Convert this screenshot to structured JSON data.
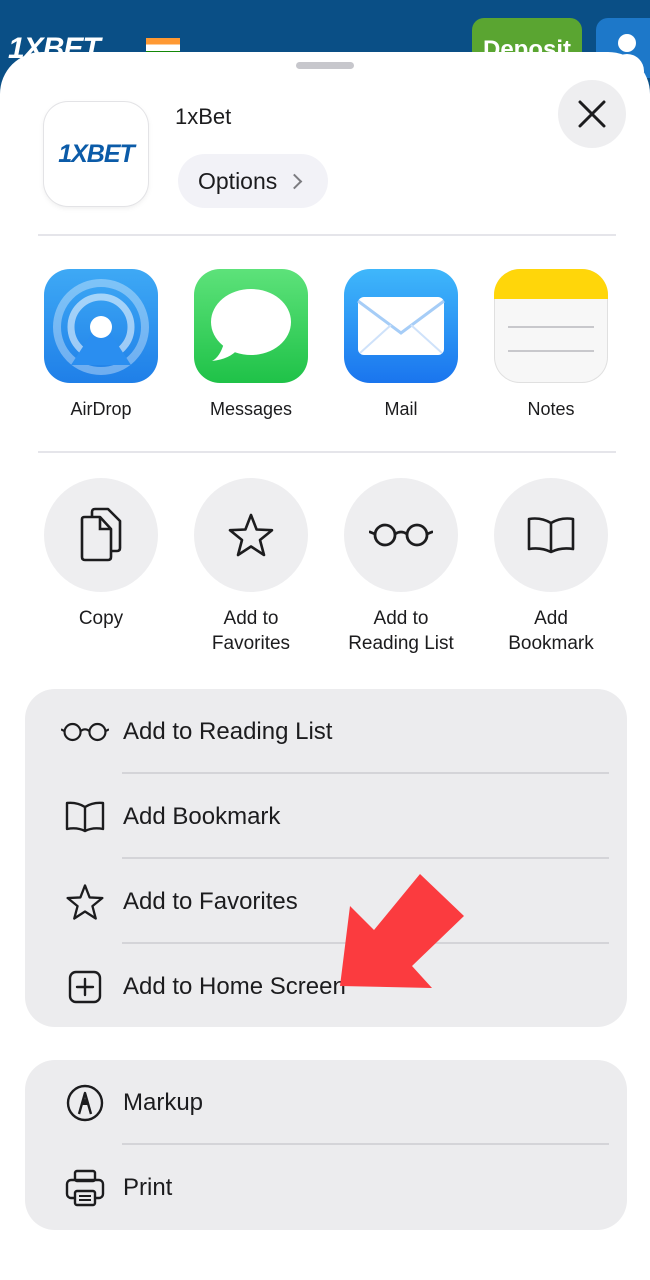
{
  "background_site": {
    "logo": "1XBET",
    "deposit_label": "Deposit"
  },
  "header": {
    "app_logo": "1XBET",
    "site_name": "1xBet",
    "options_label": "Options",
    "close_icon": "close-icon"
  },
  "apps": [
    {
      "label": "AirDrop",
      "icon": "airdrop-icon"
    },
    {
      "label": "Messages",
      "icon": "messages-icon"
    },
    {
      "label": "Mail",
      "icon": "mail-icon"
    },
    {
      "label": "Notes",
      "icon": "notes-icon"
    }
  ],
  "actions": [
    {
      "label": "Copy",
      "icon": "copy-icon"
    },
    {
      "label": "Add to\nFavorites",
      "icon": "star-icon"
    },
    {
      "label": "Add to\nReading List",
      "icon": "glasses-icon"
    },
    {
      "label": "Add\nBookmark",
      "icon": "book-icon"
    }
  ],
  "list_group_1": [
    {
      "label": "Add to Reading List",
      "icon": "glasses-icon"
    },
    {
      "label": "Add Bookmark",
      "icon": "book-icon"
    },
    {
      "label": "Add to Favorites",
      "icon": "star-icon"
    },
    {
      "label": "Add to Home Screen",
      "icon": "plus-square-icon"
    }
  ],
  "list_group_2": [
    {
      "label": "Markup",
      "icon": "markup-icon"
    },
    {
      "label": "Print",
      "icon": "printer-icon"
    }
  ],
  "colors": {
    "arrow": "#fb3b3f",
    "site_header": "#0a4f86",
    "sheet": "#ffffff"
  }
}
